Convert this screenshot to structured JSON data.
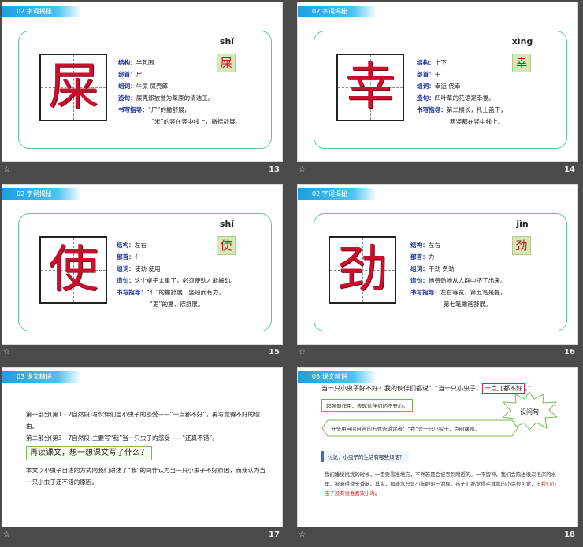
{
  "slides": [
    {
      "tag": "02  字词揭秘",
      "number": "13",
      "char": "屎",
      "pinyin": "shǐ",
      "rows": [
        {
          "k": "结构：",
          "v": "半包围"
        },
        {
          "k": "部首：",
          "v": "尸"
        },
        {
          "k": "组词：",
          "v": "牛屎  屎壳郎"
        },
        {
          "k": "造句：",
          "v": "屎壳郎被誉为草原的清洁工。"
        },
        {
          "k": "书写指导：",
          "v": "“尸”的撇舒展，"
        }
      ],
      "extra": "“米”的竖在竖中线上，撇捺舒展。"
    },
    {
      "tag": "02  字词揭秘",
      "number": "14",
      "char": "幸",
      "pinyin": "xìng",
      "rows": [
        {
          "k": "结构：",
          "v": "上下"
        },
        {
          "k": "部首：",
          "v": "干"
        },
        {
          "k": "组词：",
          "v": "幸运  侥幸"
        },
        {
          "k": "造句：",
          "v": "四叶草的花语是幸福。"
        },
        {
          "k": "书写指导：",
          "v": "第二横长，托上盖下，"
        }
      ],
      "extra": "两竖都在竖中线上。"
    },
    {
      "tag": "02  字词揭秘",
      "number": "15",
      "char": "使",
      "pinyin": "shǐ",
      "rows": [
        {
          "k": "结构：",
          "v": "左右"
        },
        {
          "k": "部首：",
          "v": "亻"
        },
        {
          "k": "组词：",
          "v": "使劲  使用"
        },
        {
          "k": "造句：",
          "v": "这个桌子太重了，必须使劲才能搬动。"
        },
        {
          "k": "书写指导：",
          "v": "“亻”的撇舒展，竖短而有力，"
        }
      ],
      "extra": "“吏”的撇、捺舒展。"
    },
    {
      "tag": "02  字词揭秘",
      "number": "16",
      "char": "劲",
      "pinyin": "jìn",
      "rows": [
        {
          "k": "结构：",
          "v": "左右"
        },
        {
          "k": "部首：",
          "v": "力"
        },
        {
          "k": "组词：",
          "v": "干劲  费劲"
        },
        {
          "k": "造句：",
          "v": "他费劲地从人群中挤了出来。"
        },
        {
          "k": "书写指导：",
          "v": "左右等宽，第五笔是提，"
        }
      ],
      "extra": "第七笔撇画舒展。"
    }
  ],
  "slide17": {
    "tag": "03  课文精讲",
    "number": "17",
    "p1": "第一部分(第1 - 2自然段)写伙伴们当小虫子的感受——“一点都不好”，再写觉得不好的理由。",
    "p2": "第二部分(第3 - 7自然段)主要写“我”当一只虫子的感受——“还真不错”。",
    "highlight": "再读课文，想一想课文写了什么？",
    "p3": "本文以小虫子自述的方式向我们讲述了“我”的同伴认为当一只小虫子不好原因，而我认为当一只小虫子还不错的原因。"
  },
  "slide18": {
    "tag": "03  课文精讲",
    "number": "18",
    "question_pre": "当一只小虫子好不好？我的伙伴们都说：“当一只小虫子，",
    "question_box": "一点儿都不好",
    "question_post": "。”",
    "box1": "起强调作用，表现伙伴们的不开心。",
    "box2": "开头用自问自答的方式告诉读者：“我”是一只小虫子，点明课题。",
    "burst": "设问句",
    "discuss": "讨论：小虫子的生活有哪些烦恼？",
    "para_normal": "我们睡觉挑挑的时候，一定要看准地方，不然若是会被吞到附近的。一不留神，我们会陷进很深很深的水里，被淹得昏头昏脑。其实，那滴水只是小狗眼的一泡尿。孩子们都觉得毛茸茸的小鸟很可爱，但",
    "para_red": "我们小虫子没有谁会喜欢小鸟",
    "para_end": "。"
  },
  "colors": {
    "accent": "#1e9fe0",
    "card_border": "#5fc7a4",
    "char_red": "#c8102e",
    "label_blue": "#1a2fa0"
  }
}
